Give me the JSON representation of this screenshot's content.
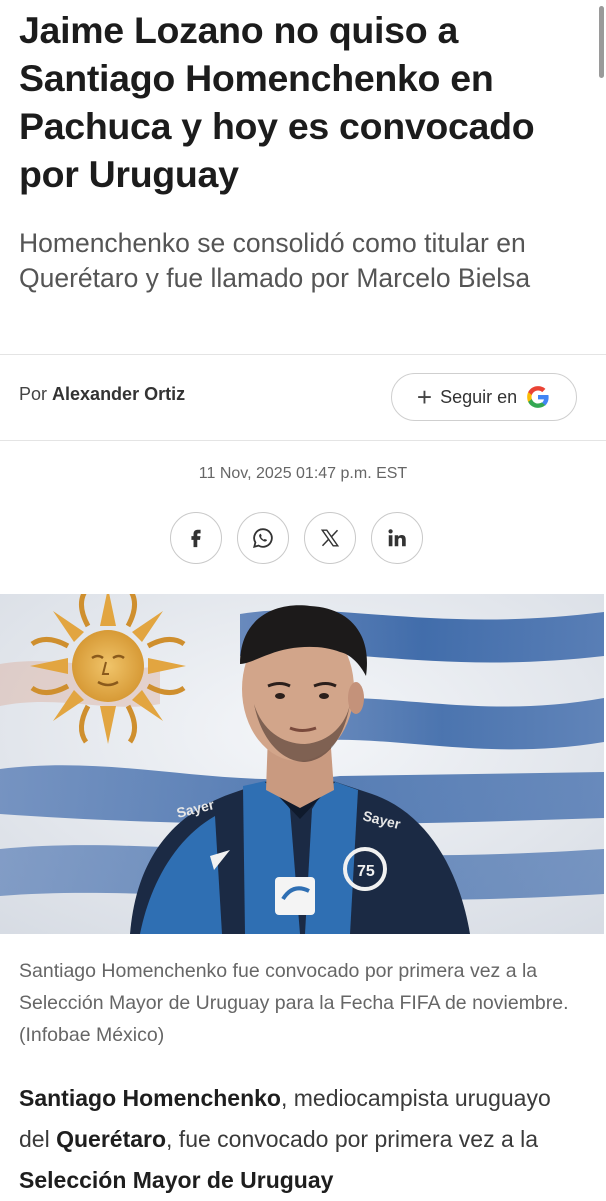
{
  "article": {
    "headline": "Jaime Lozano no quiso a Santiago Homenchenko en Pachuca y hoy es convocado por Uruguay",
    "subheadline": "Homenchenko se consolidó como titular en Querétaro y fue llamado por Marcelo Bielsa",
    "byline_prefix": "Por",
    "author": "Alexander Ortiz",
    "follow_label": "Seguir en",
    "date": "11 Nov, 2025 01:47 p.m. EST",
    "share_icons": [
      "facebook-icon",
      "whatsapp-icon",
      "x-icon",
      "linkedin-icon"
    ],
    "image_caption": "Santiago Homenchenko fue convocado por primera vez a la Selección Mayor de Uruguay para la Fecha FIFA de noviembre. (Infobae México)",
    "body": {
      "p1_bold1": "Santiago Homenchenko",
      "p1_text1": ", mediocampista uruguayo del ",
      "p1_bold2": "Querétaro",
      "p1_text2": ", fue convocado por primera vez a la ",
      "p1_bold3": "Selección Mayor de Uruguay"
    }
  },
  "colors": {
    "google_blue": "#4285F4",
    "google_red": "#EA4335",
    "google_yellow": "#FBBC05",
    "google_green": "#34A853",
    "jersey_navy": "#1b2a44",
    "jersey_blue": "#2f6fb3"
  }
}
